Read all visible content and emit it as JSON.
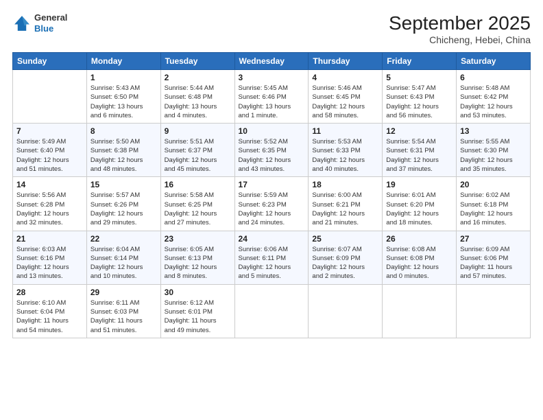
{
  "header": {
    "logo": {
      "line1": "General",
      "line2": "Blue"
    },
    "title": "September 2025",
    "subtitle": "Chicheng, Hebei, China"
  },
  "weekdays": [
    "Sunday",
    "Monday",
    "Tuesday",
    "Wednesday",
    "Thursday",
    "Friday",
    "Saturday"
  ],
  "weeks": [
    [
      {
        "day": "",
        "info": ""
      },
      {
        "day": "1",
        "info": "Sunrise: 5:43 AM\nSunset: 6:50 PM\nDaylight: 13 hours\nand 6 minutes."
      },
      {
        "day": "2",
        "info": "Sunrise: 5:44 AM\nSunset: 6:48 PM\nDaylight: 13 hours\nand 4 minutes."
      },
      {
        "day": "3",
        "info": "Sunrise: 5:45 AM\nSunset: 6:46 PM\nDaylight: 13 hours\nand 1 minute."
      },
      {
        "day": "4",
        "info": "Sunrise: 5:46 AM\nSunset: 6:45 PM\nDaylight: 12 hours\nand 58 minutes."
      },
      {
        "day": "5",
        "info": "Sunrise: 5:47 AM\nSunset: 6:43 PM\nDaylight: 12 hours\nand 56 minutes."
      },
      {
        "day": "6",
        "info": "Sunrise: 5:48 AM\nSunset: 6:42 PM\nDaylight: 12 hours\nand 53 minutes."
      }
    ],
    [
      {
        "day": "7",
        "info": "Sunrise: 5:49 AM\nSunset: 6:40 PM\nDaylight: 12 hours\nand 51 minutes."
      },
      {
        "day": "8",
        "info": "Sunrise: 5:50 AM\nSunset: 6:38 PM\nDaylight: 12 hours\nand 48 minutes."
      },
      {
        "day": "9",
        "info": "Sunrise: 5:51 AM\nSunset: 6:37 PM\nDaylight: 12 hours\nand 45 minutes."
      },
      {
        "day": "10",
        "info": "Sunrise: 5:52 AM\nSunset: 6:35 PM\nDaylight: 12 hours\nand 43 minutes."
      },
      {
        "day": "11",
        "info": "Sunrise: 5:53 AM\nSunset: 6:33 PM\nDaylight: 12 hours\nand 40 minutes."
      },
      {
        "day": "12",
        "info": "Sunrise: 5:54 AM\nSunset: 6:31 PM\nDaylight: 12 hours\nand 37 minutes."
      },
      {
        "day": "13",
        "info": "Sunrise: 5:55 AM\nSunset: 6:30 PM\nDaylight: 12 hours\nand 35 minutes."
      }
    ],
    [
      {
        "day": "14",
        "info": "Sunrise: 5:56 AM\nSunset: 6:28 PM\nDaylight: 12 hours\nand 32 minutes."
      },
      {
        "day": "15",
        "info": "Sunrise: 5:57 AM\nSunset: 6:26 PM\nDaylight: 12 hours\nand 29 minutes."
      },
      {
        "day": "16",
        "info": "Sunrise: 5:58 AM\nSunset: 6:25 PM\nDaylight: 12 hours\nand 27 minutes."
      },
      {
        "day": "17",
        "info": "Sunrise: 5:59 AM\nSunset: 6:23 PM\nDaylight: 12 hours\nand 24 minutes."
      },
      {
        "day": "18",
        "info": "Sunrise: 6:00 AM\nSunset: 6:21 PM\nDaylight: 12 hours\nand 21 minutes."
      },
      {
        "day": "19",
        "info": "Sunrise: 6:01 AM\nSunset: 6:20 PM\nDaylight: 12 hours\nand 18 minutes."
      },
      {
        "day": "20",
        "info": "Sunrise: 6:02 AM\nSunset: 6:18 PM\nDaylight: 12 hours\nand 16 minutes."
      }
    ],
    [
      {
        "day": "21",
        "info": "Sunrise: 6:03 AM\nSunset: 6:16 PM\nDaylight: 12 hours\nand 13 minutes."
      },
      {
        "day": "22",
        "info": "Sunrise: 6:04 AM\nSunset: 6:14 PM\nDaylight: 12 hours\nand 10 minutes."
      },
      {
        "day": "23",
        "info": "Sunrise: 6:05 AM\nSunset: 6:13 PM\nDaylight: 12 hours\nand 8 minutes."
      },
      {
        "day": "24",
        "info": "Sunrise: 6:06 AM\nSunset: 6:11 PM\nDaylight: 12 hours\nand 5 minutes."
      },
      {
        "day": "25",
        "info": "Sunrise: 6:07 AM\nSunset: 6:09 PM\nDaylight: 12 hours\nand 2 minutes."
      },
      {
        "day": "26",
        "info": "Sunrise: 6:08 AM\nSunset: 6:08 PM\nDaylight: 12 hours\nand 0 minutes."
      },
      {
        "day": "27",
        "info": "Sunrise: 6:09 AM\nSunset: 6:06 PM\nDaylight: 11 hours\nand 57 minutes."
      }
    ],
    [
      {
        "day": "28",
        "info": "Sunrise: 6:10 AM\nSunset: 6:04 PM\nDaylight: 11 hours\nand 54 minutes."
      },
      {
        "day": "29",
        "info": "Sunrise: 6:11 AM\nSunset: 6:03 PM\nDaylight: 11 hours\nand 51 minutes."
      },
      {
        "day": "30",
        "info": "Sunrise: 6:12 AM\nSunset: 6:01 PM\nDaylight: 11 hours\nand 49 minutes."
      },
      {
        "day": "",
        "info": ""
      },
      {
        "day": "",
        "info": ""
      },
      {
        "day": "",
        "info": ""
      },
      {
        "day": "",
        "info": ""
      }
    ]
  ]
}
